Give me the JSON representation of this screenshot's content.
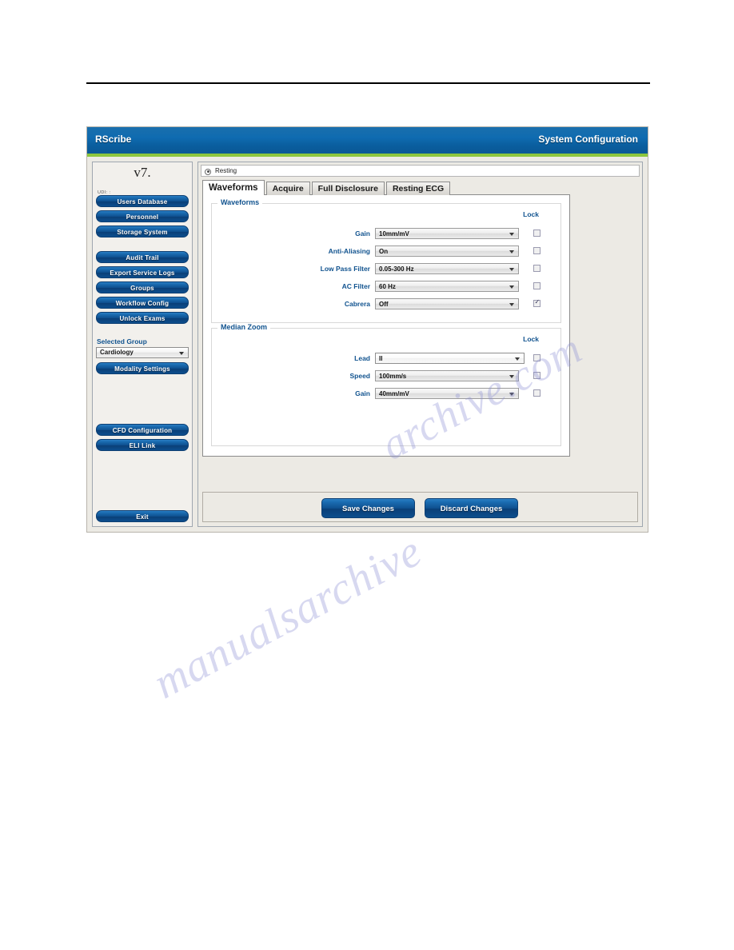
{
  "window": {
    "title_left": "RScribe",
    "title_right": "System Configuration",
    "accent_blue": "#0a5e9e",
    "accent_green": "#8cc63e",
    "label_blue": "#11538f"
  },
  "sidebar": {
    "version": "v7.",
    "udi": "UDI: :",
    "nav_group_1": [
      {
        "label": "Users Database",
        "name": "users-database"
      },
      {
        "label": "Personnel",
        "name": "personnel"
      },
      {
        "label": "Storage System",
        "name": "storage-system"
      }
    ],
    "nav_group_2": [
      {
        "label": "Audit Trail",
        "name": "audit-trail"
      },
      {
        "label": "Export Service Logs",
        "name": "export-service-logs"
      },
      {
        "label": "Groups",
        "name": "groups"
      },
      {
        "label": "Workflow Config",
        "name": "workflow-config"
      },
      {
        "label": "Unlock Exams",
        "name": "unlock-exams"
      }
    ],
    "selected_group_label": "Selected Group",
    "selected_group_value": "Cardiology",
    "modality_settings_label": "Modality Settings",
    "nav_group_3": [
      {
        "label": "CFD Configuration",
        "name": "cfd-configuration"
      },
      {
        "label": "ELI Link",
        "name": "eli-link"
      }
    ],
    "exit_label": "Exit"
  },
  "content": {
    "mode": "Resting",
    "mode_icon": "radio-selected-icon",
    "tabs": [
      {
        "label": "Waveforms",
        "active": true
      },
      {
        "label": "Acquire",
        "active": false
      },
      {
        "label": "Full Disclosure",
        "active": false
      },
      {
        "label": "Resting ECG",
        "active": false
      }
    ],
    "lock_header": "Lock",
    "sections": [
      {
        "legend": "Waveforms",
        "rows": [
          {
            "label": "Gain",
            "value": "10mm/mV",
            "locked": false
          },
          {
            "label": "Anti-Aliasing",
            "value": "On",
            "locked": false
          },
          {
            "label": "Low Pass Filter",
            "value": "0.05-300 Hz",
            "locked": false
          },
          {
            "label": "AC Filter",
            "value": "60 Hz",
            "locked": false
          },
          {
            "label": "Cabrera",
            "value": "Off",
            "locked": true
          }
        ]
      },
      {
        "legend": "Median Zoom",
        "rows": [
          {
            "label": "Lead",
            "value": "II",
            "locked": false
          },
          {
            "label": "Speed",
            "value": "100mm/s",
            "locked": false
          },
          {
            "label": "Gain",
            "value": "40mm/mV",
            "locked": false
          }
        ]
      }
    ],
    "save_label": "Save Changes",
    "discard_label": "Discard Changes"
  },
  "watermark": {
    "line1": "manualsarchive",
    "line2": "archive.com"
  }
}
